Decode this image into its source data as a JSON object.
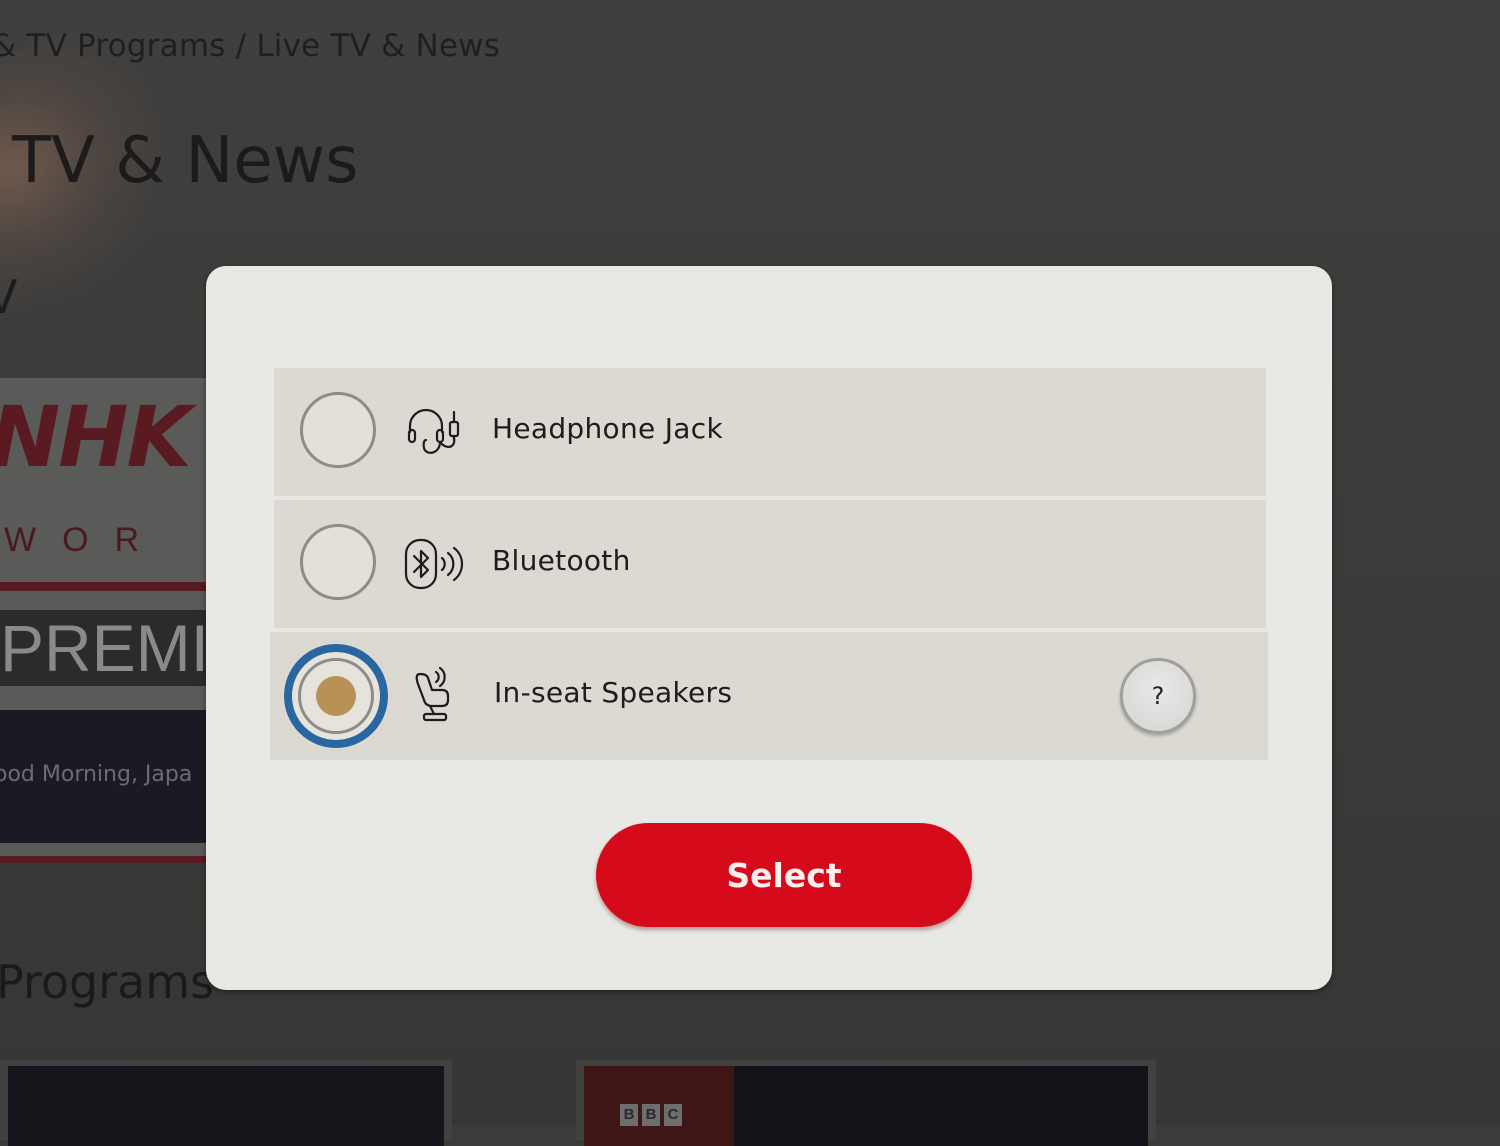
{
  "background_page": {
    "breadcrumb": "& TV Programs / Live TV & News",
    "page_title": "TV & News",
    "section_live": "V",
    "nhk_card": {
      "logo": "NHK",
      "world": "WOR",
      "premium": "PREMI",
      "program_title": "ood Morning, Japa"
    },
    "section_programs": "Programs",
    "bbc_letters": [
      "B",
      "B",
      "C"
    ]
  },
  "modal": {
    "options": [
      {
        "label": "Headphone Jack",
        "icon": "headphone-jack-icon",
        "selected": false
      },
      {
        "label": "Bluetooth",
        "icon": "bluetooth-icon",
        "selected": false
      },
      {
        "label": "In-seat Speakers",
        "icon": "seat-speaker-icon",
        "selected": true
      }
    ],
    "help_label": "?",
    "select_label": "Select"
  },
  "colors": {
    "accent_red": "#d50b1b",
    "selection_blue": "#2a66a0",
    "selected_dot": "#b89255"
  }
}
